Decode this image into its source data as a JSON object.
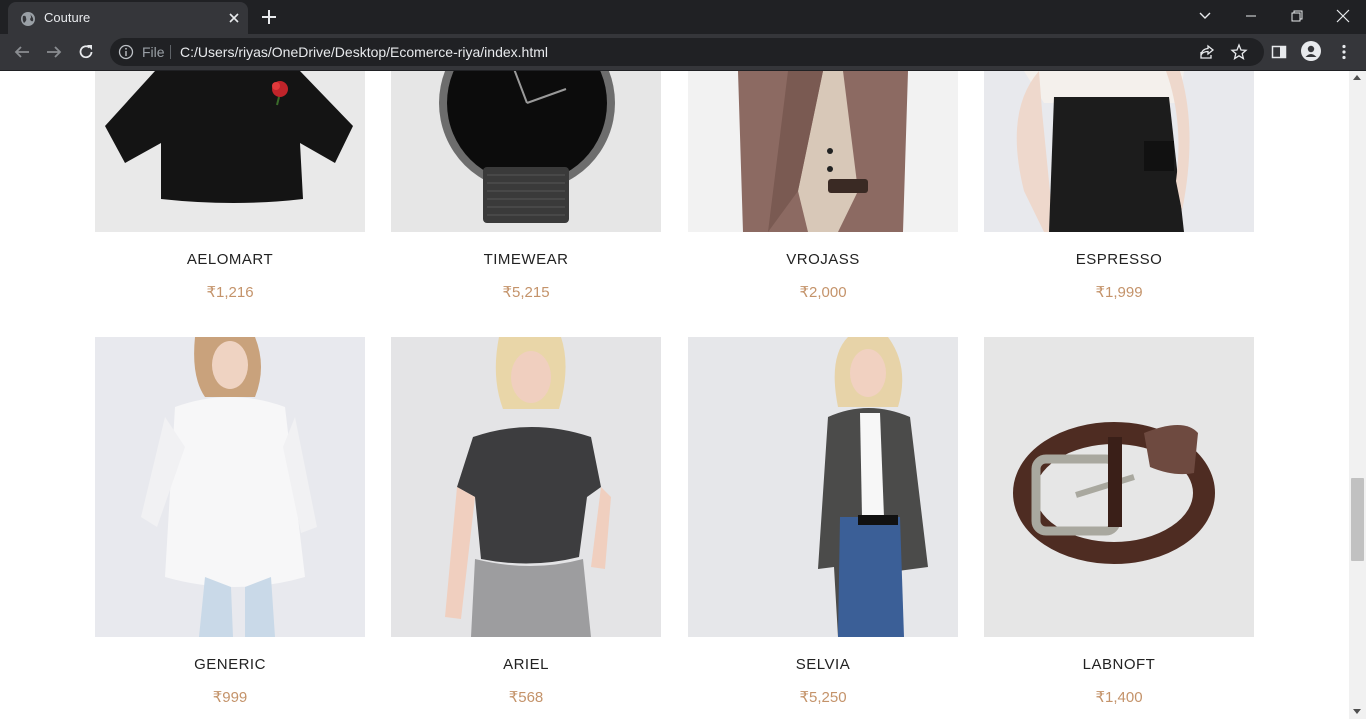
{
  "browser": {
    "tab_title": "Couture",
    "scheme_label": "File",
    "url": "C:/Users/riyas/OneDrive/Desktop/Ecomerce-riya/index.html"
  },
  "theme": {
    "price_color": "#c4936a",
    "name_color": "#222222",
    "chrome_dark": "#202124",
    "chrome_tab": "#35363a"
  },
  "products": [
    {
      "name": "AELOMART",
      "price": "₹1,216",
      "image": "black-tshirt-rose-image"
    },
    {
      "name": "TIMEWEAR",
      "price": "₹5,215",
      "image": "mesh-watch-image"
    },
    {
      "name": "VROJASS",
      "price": "₹2,000",
      "image": "mauve-suit-image"
    },
    {
      "name": "ESPRESSO",
      "price": "₹1,999",
      "image": "black-cargo-skirt-image"
    },
    {
      "name": "GENERIC",
      "price": "₹999",
      "image": "white-shirt-model-image"
    },
    {
      "name": "ARIEL",
      "price": "₹568",
      "image": "grey-tee-model-image"
    },
    {
      "name": "SELVIA",
      "price": "₹5,250",
      "image": "check-blazer-model-image"
    },
    {
      "name": "LABNOFT",
      "price": "₹1,400",
      "image": "leather-belt-image"
    }
  ]
}
